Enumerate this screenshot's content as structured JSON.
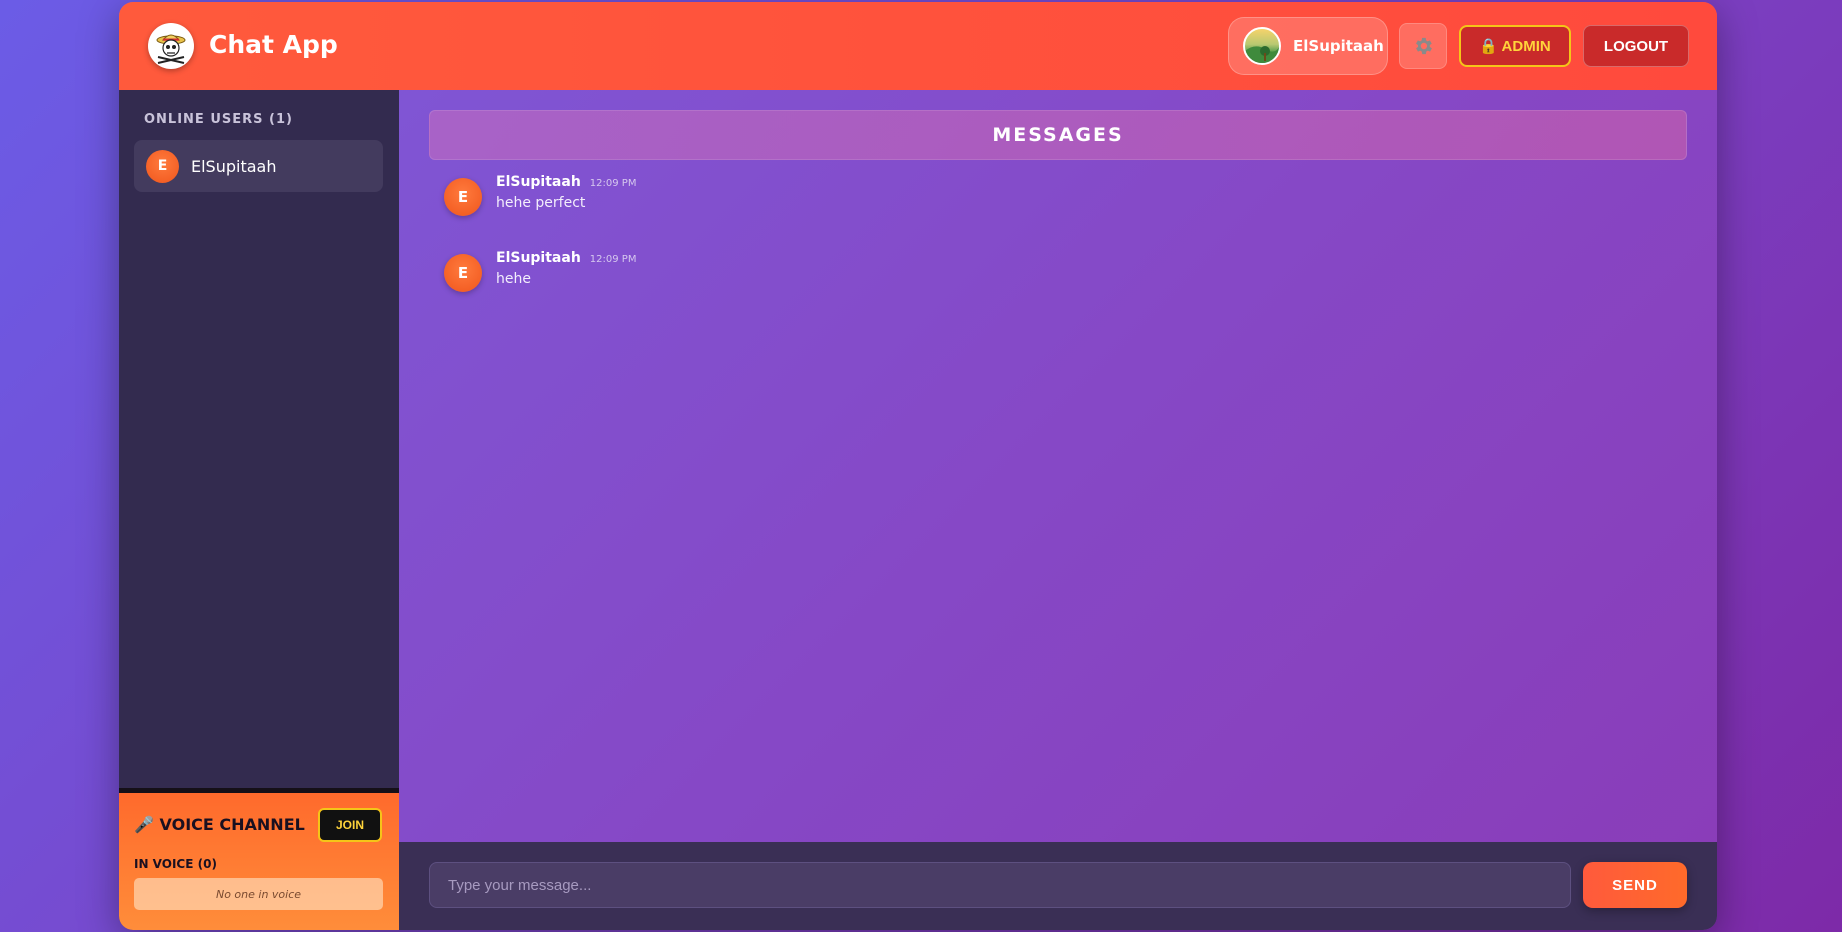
{
  "header": {
    "app_title": "Chat App",
    "logo_icon": "straw-hat-skull-icon",
    "user_name": "ElSupitaah",
    "settings_icon": "gear-icon",
    "admin_label": "🔒 ADMIN",
    "logout_label": "LOGOUT"
  },
  "sidebar": {
    "heading": "ONLINE USERS (1)",
    "users": [
      {
        "initial": "E",
        "name": "ElSupitaah"
      }
    ]
  },
  "voice": {
    "title": "🎤 VOICE CHANNEL",
    "join_label": "JOIN",
    "in_voice_label": "IN VOICE (0)",
    "empty_text": "No one in voice"
  },
  "main": {
    "messages_header": "MESSAGES",
    "messages": [
      {
        "initial": "E",
        "author": "ElSupitaah",
        "time": "12:09 PM",
        "text": "hehe perfect"
      },
      {
        "initial": "E",
        "author": "ElSupitaah",
        "time": "12:09 PM",
        "text": "hehe"
      }
    ]
  },
  "composer": {
    "placeholder": "Type your message...",
    "send_label": "SEND"
  },
  "colors": {
    "header": "#ff4a3d",
    "accent_orange": "#ff6a2c",
    "admin_gold": "#f5c518",
    "sidebar": "#332b4f"
  }
}
